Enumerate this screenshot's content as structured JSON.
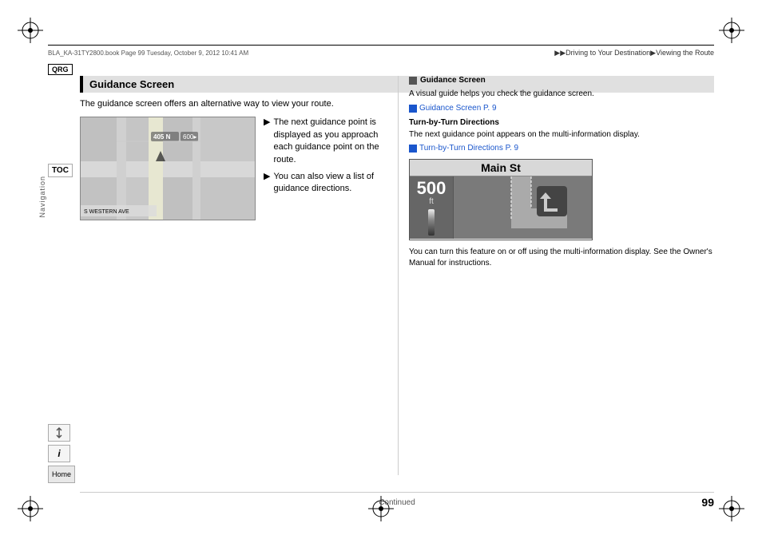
{
  "page": {
    "number": "99",
    "filename": "BLA_KA-31TY2800.book  Page 99  Tuesday, October 9, 2012  10:41 AM",
    "breadcrumb": "▶▶Driving to Your Destination▶Viewing the Route"
  },
  "badges": {
    "qrg": "QRG",
    "toc": "TOC"
  },
  "section": {
    "title": "Guidance Screen",
    "title_icon": "■",
    "intro": "The guidance screen offers an alternative way to view your route."
  },
  "bullets": [
    "The next guidance point is displayed as you approach each guidance point on the route.",
    "You can also view a list of guidance directions."
  ],
  "right_panel": {
    "header": "Guidance Screen",
    "header_icon": "■",
    "intro_text": "A visual guide helps you check the guidance screen.",
    "guidance_link": "Guidance Screen P. 9",
    "subsection_title": "Turn-by-Turn Directions",
    "subsection_text": "The next guidance point appears on the multi-information display.",
    "tbt_link": "Turn-by-Turn Directions P. 9",
    "turn_display": {
      "street": "Main St",
      "distance_number": "500",
      "distance_unit": "ft"
    },
    "bottom_text": "You can turn this feature on or off using the multi-information display. See the Owner's Manual for instructions."
  },
  "footer": {
    "continued": "Continued",
    "page": "99"
  },
  "sidebar": {
    "navigation_label": "Navigation",
    "icons": [
      {
        "name": "route-icon",
        "symbol": "↑↓"
      },
      {
        "name": "info-icon",
        "symbol": "i"
      },
      {
        "name": "home-label",
        "symbol": "Home"
      }
    ]
  }
}
